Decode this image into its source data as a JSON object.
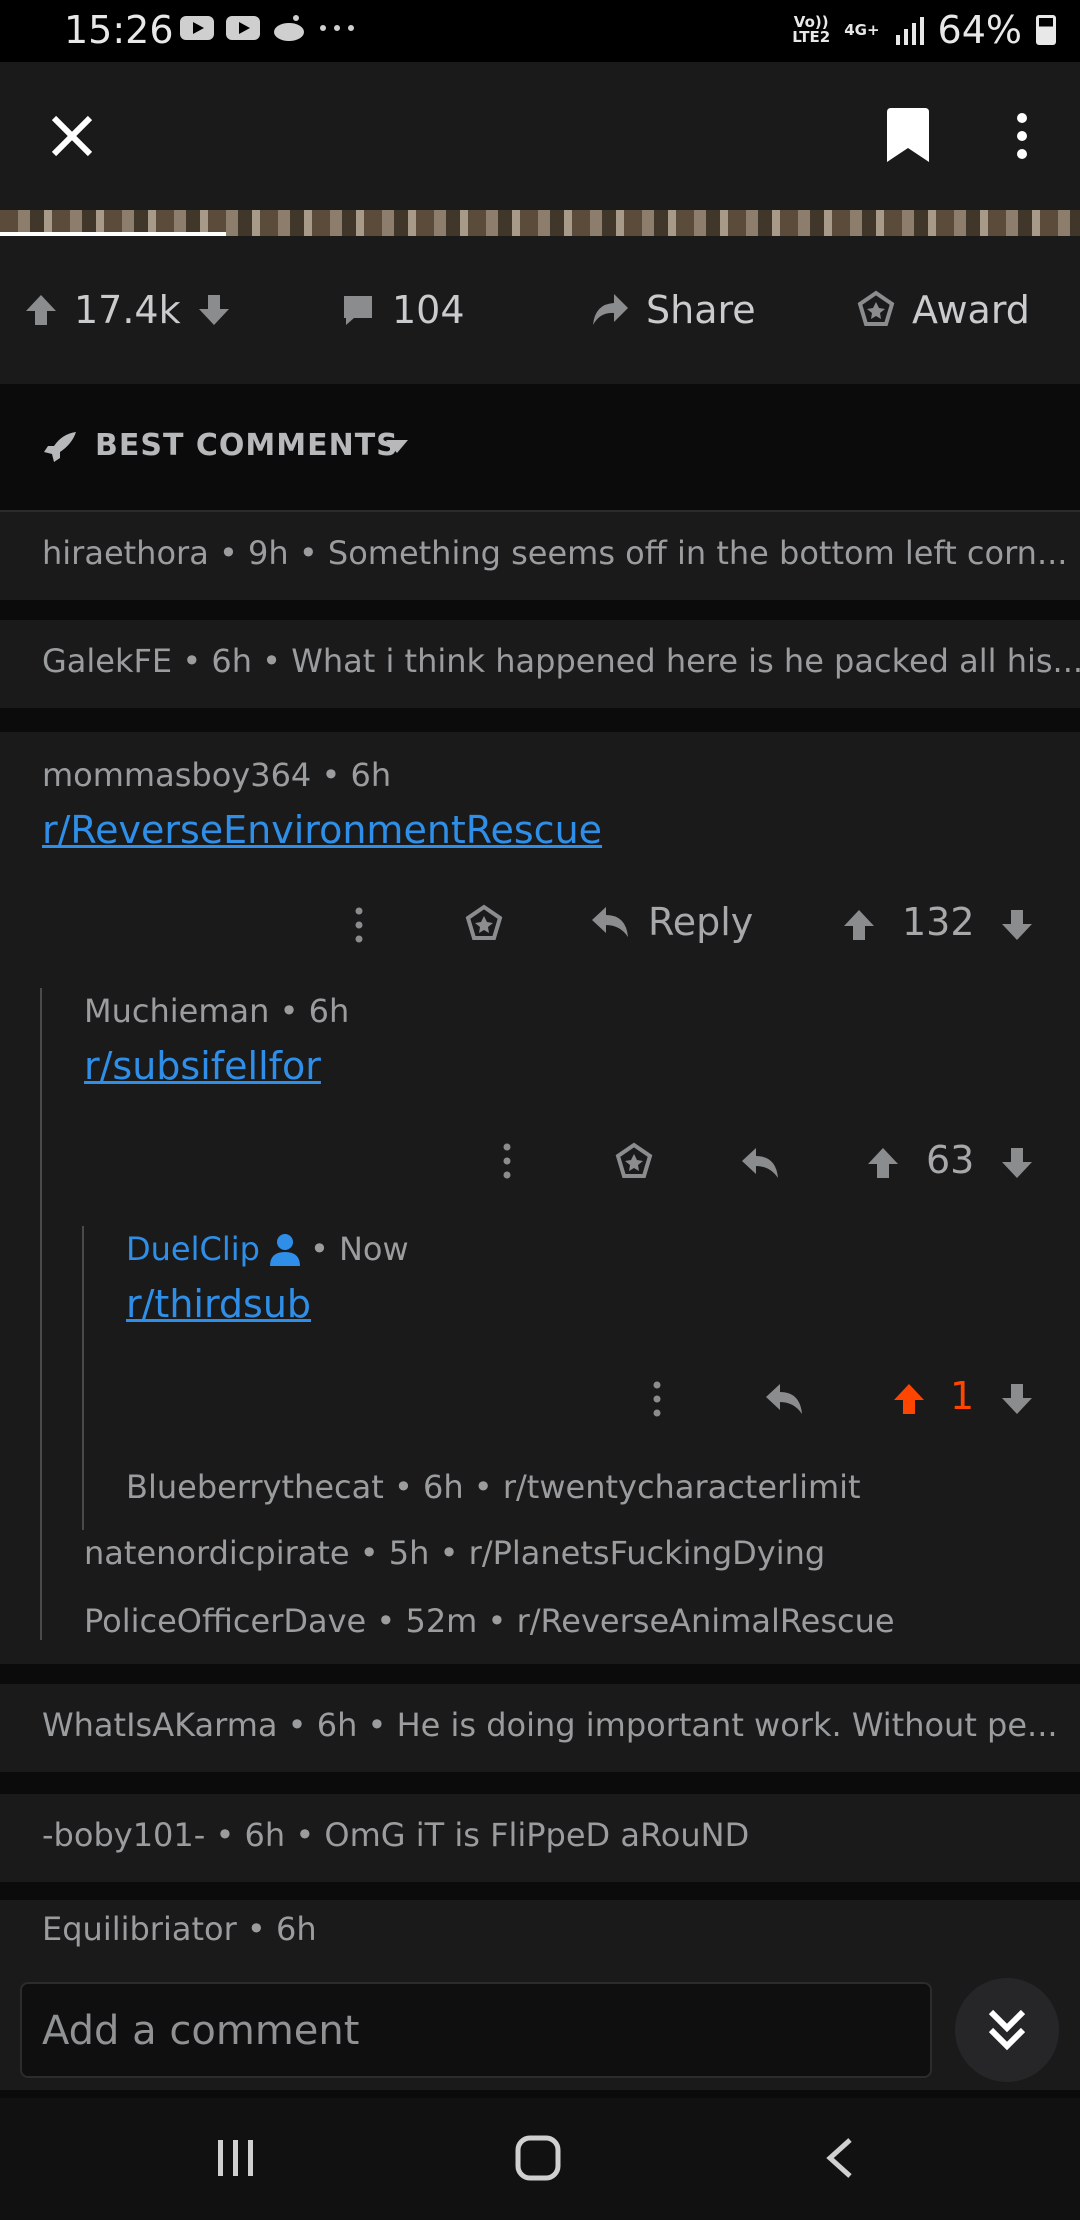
{
  "status_bar": {
    "time": "15:26",
    "network_top": "Vo))",
    "network_bottom": "LTE2",
    "network_type": "4G+",
    "battery": "64%"
  },
  "post_actions": {
    "upvotes": "17.4k",
    "comments": "104",
    "share": "Share",
    "award": "Award"
  },
  "sort": {
    "label": "BEST COMMENTS"
  },
  "collapsed_comments": [
    {
      "text": "hiraethora • 9h • Something seems off in the bottom left corn..."
    },
    {
      "text": "GalekFE • 6h • What i think happened here is he packed all his..."
    },
    {
      "text": "WhatIsAKarma • 6h • He is doing important work. Without pe..."
    },
    {
      "text": "-boby101- • 6h • OmG iT is FliPpeD aRouND"
    }
  ],
  "thread": {
    "c1": {
      "meta": "mommasboy364 • 6h",
      "body": "r/ReverseEnvironmentRescue",
      "reply": "Reply",
      "score": "132"
    },
    "c2": {
      "meta": "Muchieman • 6h",
      "body": "r/subsifellfor",
      "score": "63"
    },
    "c3": {
      "author": "DuelClip",
      "time": "• Now",
      "body": "r/thirdsub",
      "score": "1"
    },
    "collapsed_children": [
      "Blueberrythecat • 6h • r/twentycharacterlimit",
      "natenordicpirate • 5h • r/PlanetsFuckingDying",
      "PoliceOfficerDave • 52m • r/ReverseAnimalRescue"
    ]
  },
  "next_comment": {
    "meta": "Equilibriator • 6h"
  },
  "composer": {
    "placeholder": "Add a comment"
  },
  "colors": {
    "background": "#0b0b0c",
    "card": "#1a1a1b",
    "link": "#2f8fe8",
    "upvote_active": "#ff4500"
  }
}
